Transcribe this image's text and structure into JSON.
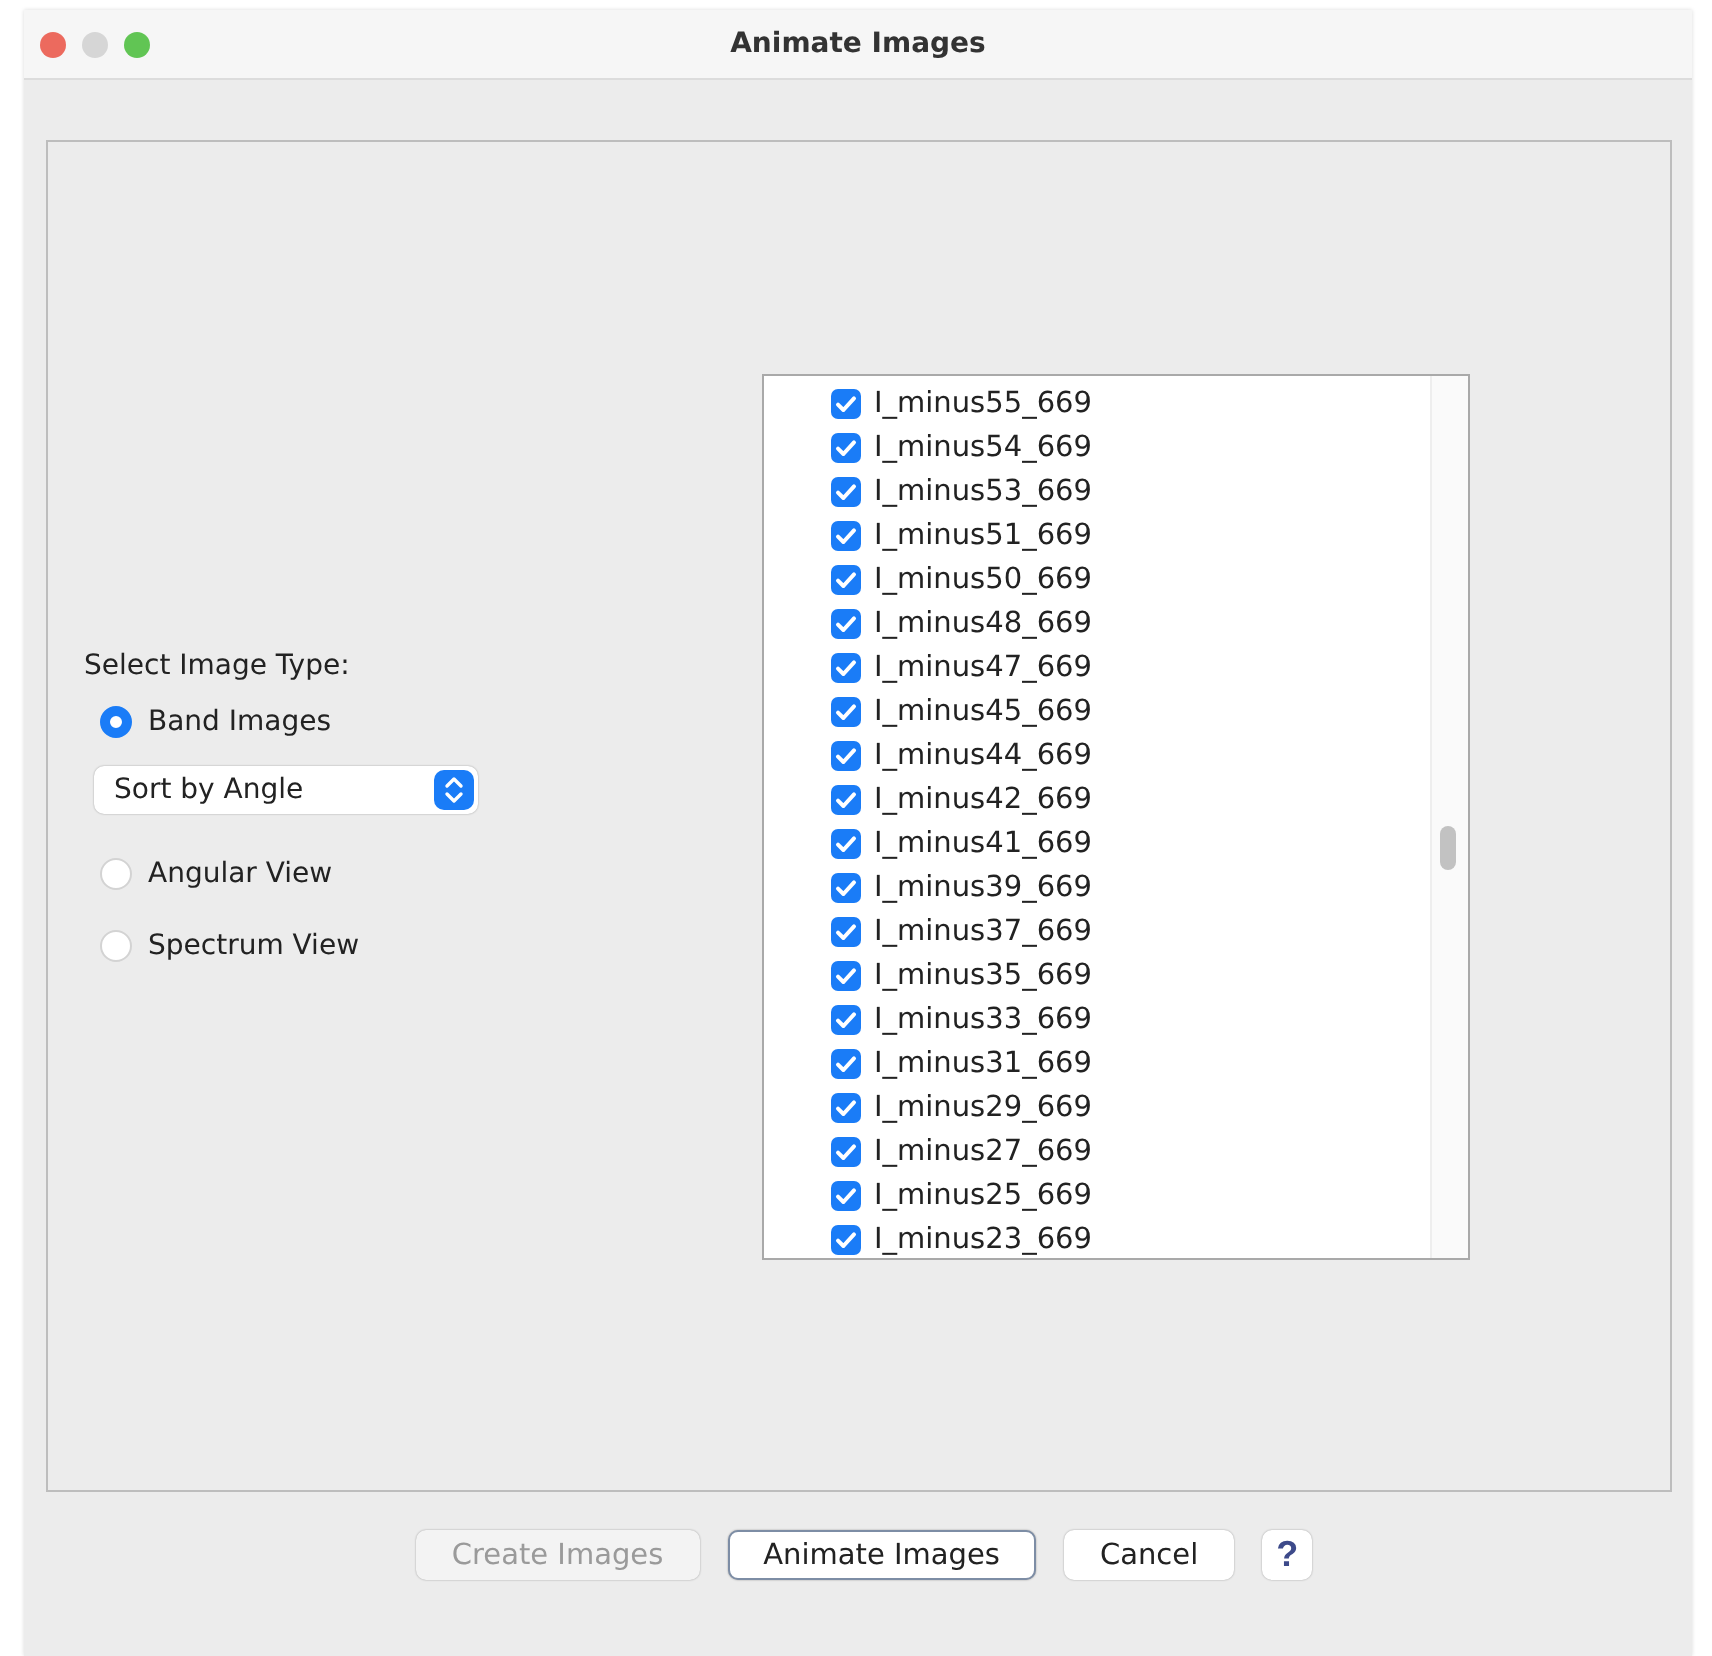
{
  "window": {
    "title": "Animate Images"
  },
  "image_type": {
    "label": "Select Image Type:",
    "options": [
      {
        "kind": "radio",
        "label": "Band Images",
        "selected": true
      },
      {
        "kind": "dropdown",
        "value": "Sort by Angle"
      },
      {
        "kind": "radio",
        "label": "Angular View",
        "selected": false
      },
      {
        "kind": "radio",
        "label": "Spectrum View",
        "selected": false
      }
    ]
  },
  "image_list": [
    {
      "label": "I_minus55_669",
      "checked": true
    },
    {
      "label": "I_minus54_669",
      "checked": true
    },
    {
      "label": "I_minus53_669",
      "checked": true
    },
    {
      "label": "I_minus51_669",
      "checked": true
    },
    {
      "label": "I_minus50_669",
      "checked": true
    },
    {
      "label": "I_minus48_669",
      "checked": true
    },
    {
      "label": "I_minus47_669",
      "checked": true
    },
    {
      "label": "I_minus45_669",
      "checked": true
    },
    {
      "label": "I_minus44_669",
      "checked": true
    },
    {
      "label": "I_minus42_669",
      "checked": true
    },
    {
      "label": "I_minus41_669",
      "checked": true
    },
    {
      "label": "I_minus39_669",
      "checked": true
    },
    {
      "label": "I_minus37_669",
      "checked": true
    },
    {
      "label": "I_minus35_669",
      "checked": true
    },
    {
      "label": "I_minus33_669",
      "checked": true
    },
    {
      "label": "I_minus31_669",
      "checked": true
    },
    {
      "label": "I_minus29_669",
      "checked": true
    },
    {
      "label": "I_minus27_669",
      "checked": true
    },
    {
      "label": "I_minus25_669",
      "checked": true
    },
    {
      "label": "I_minus23_669",
      "checked": true
    }
  ],
  "buttons": [
    {
      "kind": "push",
      "label": "Create Images",
      "disabled": true,
      "default": false
    },
    {
      "kind": "push",
      "label": "Animate Images",
      "disabled": false,
      "default": true
    },
    {
      "kind": "push",
      "label": "Cancel",
      "disabled": false,
      "default": false
    },
    {
      "kind": "help",
      "label": "?"
    }
  ]
}
